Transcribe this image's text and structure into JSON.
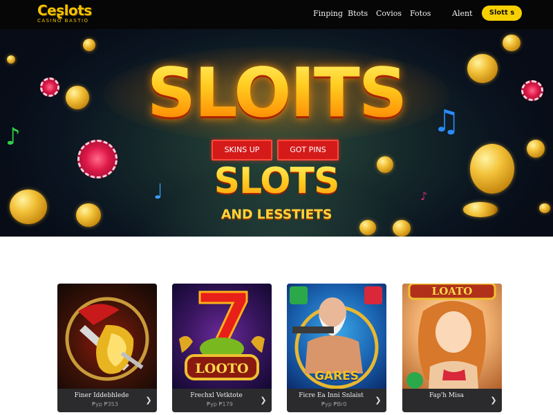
{
  "header": {
    "logo": "Ceʂlots",
    "logo_sub": "CASINO BASTIO",
    "nav": [
      "Finping",
      "Btots",
      "Covios",
      "Fotos"
    ],
    "account": "Alent",
    "cta": "Slott s"
  },
  "hero": {
    "title": "SLOITS",
    "buttons": [
      "SKINS UP",
      "GOT PINS"
    ],
    "subtitle": "SLOTS",
    "tagline": "AND LESSTIETS"
  },
  "cards": [
    {
      "title": "Finer Iddebhlede",
      "meta": "₱ур ₱353",
      "art_label": "",
      "icon": "golden-helmet-icon"
    },
    {
      "title": "Frechxl Vetktote",
      "meta": "₱ур ₱179",
      "art_label": "LOOTO",
      "icon": "lucky-seven-icon"
    },
    {
      "title": "Ficre Ea Inni Snlaist",
      "meta": "₱ур ₱Br0",
      "art_label": "GARES",
      "icon": "warrior-icon"
    },
    {
      "title": "Fap'h Misa",
      "meta": "",
      "art_label": "LOATO",
      "icon": "heroine-icon"
    }
  ],
  "colors": {
    "accent": "#f7d000",
    "hero_button": "#d51a1a",
    "header_bg": "#060606"
  }
}
